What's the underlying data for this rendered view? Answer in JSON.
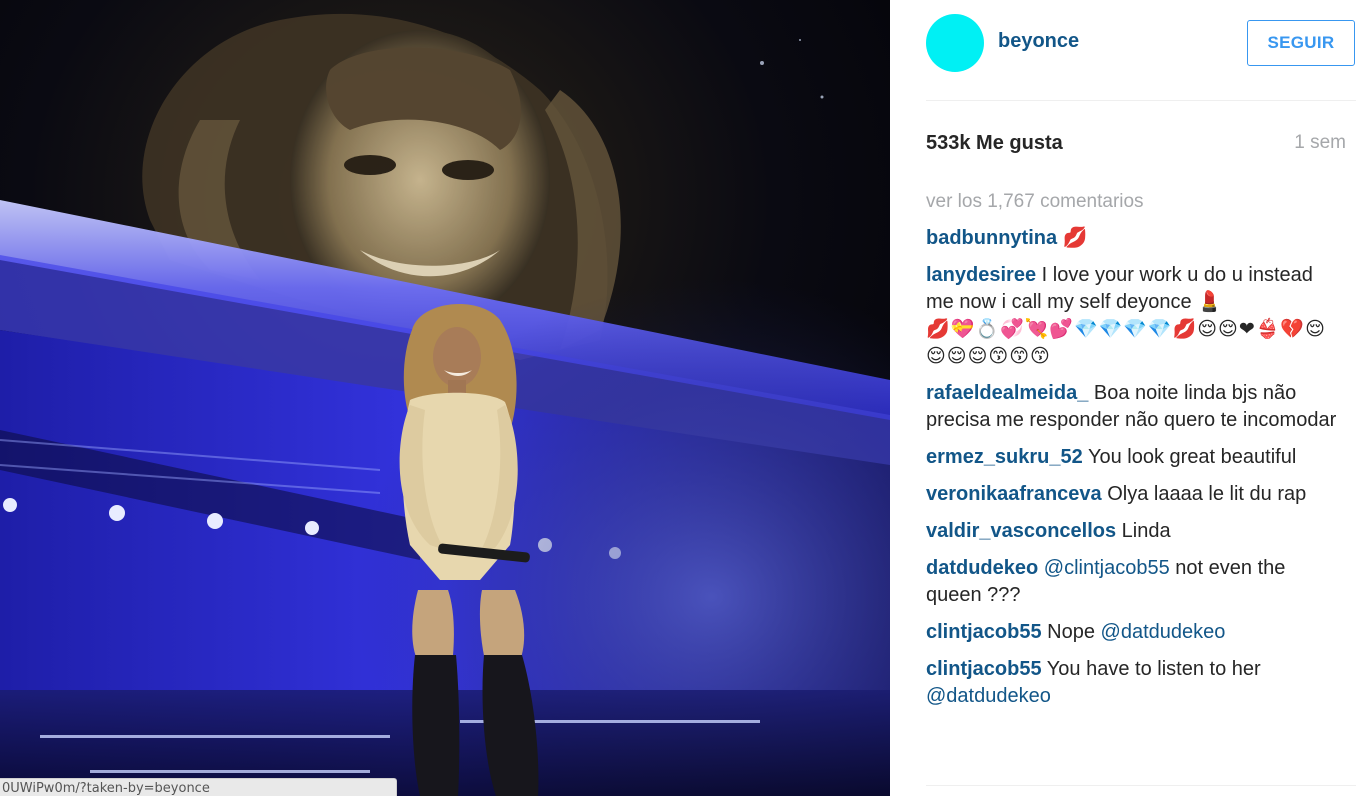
{
  "photo": {
    "description_alt": "",
    "status_url": "0UWiPw0m/?taken-by=beyonce"
  },
  "header": {
    "username": "beyonce",
    "follow_label": "SEGUIR",
    "avatar_color": "#00f0f4",
    "link_color": "#125688",
    "button_color": "#3897f0"
  },
  "stats": {
    "likes": "533k Me gusta",
    "time": "1 sem"
  },
  "comments_block": {
    "view_all": "ver los 1,767 comentarios",
    "items": [
      {
        "author": "badbunnytina",
        "text": " 💋"
      },
      {
        "author": "lanydesiree",
        "text": " I love your work u do u instead me now i call my self deyonce 💄",
        "emoji": "💋💝💍💞💘💕💎💎💎💎💋😌😌❤👙💔😌😌😌😌😙😙😙"
      },
      {
        "author": "rafaeldealmeida_",
        "text": " Boa noite linda bjs não precisa me responder não quero te incomodar"
      },
      {
        "author": "ermez_sukru_52",
        "text": " You look great beautiful"
      },
      {
        "author": "veronikaafranceva",
        "text": " Olya laaaa le lit du rap"
      },
      {
        "author": "valdir_vasconcellos",
        "text": " Linda"
      },
      {
        "author": "datdudekeo",
        "mention": " @clintjacob55",
        "text": " not even the queen ???"
      },
      {
        "author": "clintjacob55",
        "text": " Nope ",
        "mention_after": "@datdudekeo"
      },
      {
        "author": "clintjacob55",
        "text": " You have to listen to her ",
        "mention_after": "@datdudekeo"
      }
    ]
  }
}
